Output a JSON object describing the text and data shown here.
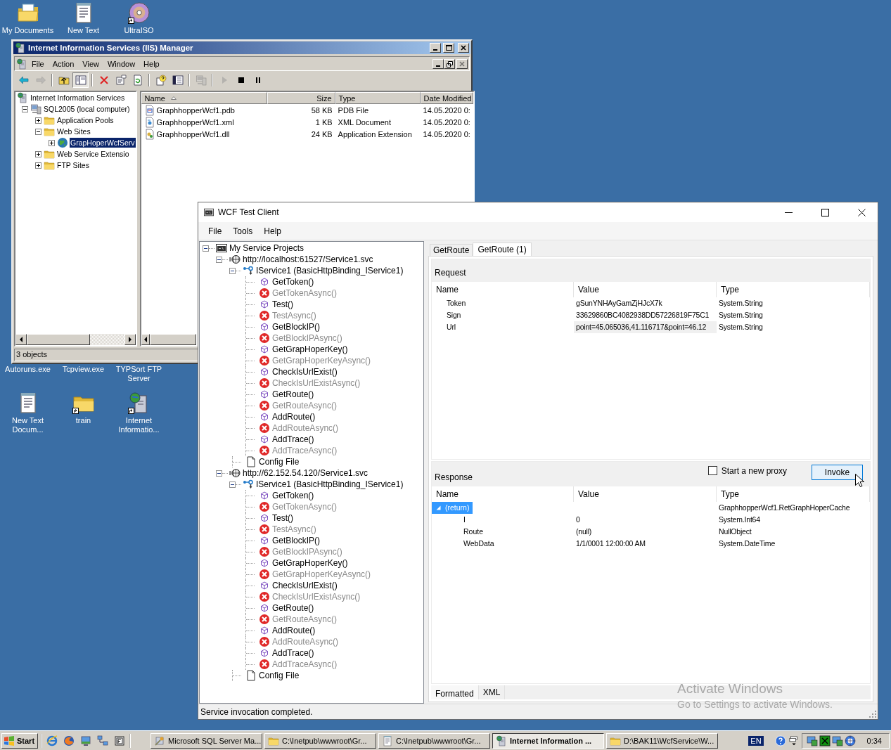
{
  "desktop_icons_top": [
    {
      "label": "My Documents",
      "kind": "documents",
      "shortcut": false
    },
    {
      "label": "New Text",
      "kind": "notepad",
      "shortcut": false
    },
    {
      "label": "UltraISO",
      "kind": "disc",
      "shortcut": true
    }
  ],
  "desktop_labels_covered": [
    "Autoruns.exe",
    "Tcpview.exe",
    "TYPSort FTP Server"
  ],
  "desktop_icons_bottom": [
    {
      "label": "New Text Docum...",
      "kind": "notepad",
      "shortcut": false
    },
    {
      "label": "train",
      "kind": "folder",
      "shortcut": true
    },
    {
      "label": "Internet Informatio...",
      "kind": "iis",
      "shortcut": true
    }
  ],
  "iis_window": {
    "title": "Internet Information Services (IIS) Manager",
    "menu": [
      "File",
      "Action",
      "View",
      "Window",
      "Help"
    ],
    "toolbar": [
      {
        "kind": "back",
        "disabled": false,
        "pressed": false
      },
      {
        "kind": "forward",
        "disabled": true,
        "pressed": false
      },
      {
        "kind": "separator"
      },
      {
        "kind": "up",
        "disabled": false,
        "pressed": false
      },
      {
        "kind": "tree",
        "disabled": false,
        "pressed": true
      },
      {
        "kind": "separator"
      },
      {
        "kind": "delete",
        "disabled": false,
        "pressed": false
      },
      {
        "kind": "properties",
        "disabled": false,
        "pressed": false
      },
      {
        "kind": "refresh",
        "disabled": false,
        "pressed": false
      },
      {
        "kind": "separator"
      },
      {
        "kind": "help",
        "disabled": false,
        "pressed": false
      },
      {
        "kind": "panel",
        "disabled": false,
        "pressed": false
      },
      {
        "kind": "separator"
      },
      {
        "kind": "computer",
        "disabled": true,
        "pressed": false
      },
      {
        "kind": "separator"
      },
      {
        "kind": "play",
        "disabled": true,
        "pressed": false
      },
      {
        "kind": "stop",
        "disabled": false,
        "pressed": false
      },
      {
        "kind": "pause",
        "disabled": false,
        "pressed": false
      }
    ],
    "tree": [
      {
        "label": "Internet Information Services",
        "kind": "iis",
        "selected": false,
        "children": [
          {
            "label": "SQL2005 (local computer)",
            "kind": "computer",
            "expanded": true,
            "selected": false,
            "children": [
              {
                "label": "Application Pools",
                "kind": "folder",
                "expanded": false,
                "selected": false
              },
              {
                "label": "Web Sites",
                "kind": "folder",
                "expanded": true,
                "selected": false,
                "children": [
                  {
                    "label": "GrapHoperWcfServ",
                    "kind": "website",
                    "expanded": false,
                    "selected": true
                  }
                ]
              },
              {
                "label": "Web Service Extensio",
                "kind": "folder",
                "expanded": false,
                "selected": false
              },
              {
                "label": "FTP Sites",
                "kind": "folder",
                "expanded": false,
                "selected": false
              }
            ]
          }
        ]
      }
    ],
    "columns": [
      {
        "label": "Name",
        "sorted": true
      },
      {
        "label": "Size",
        "sorted": false
      },
      {
        "label": "Type",
        "sorted": false
      },
      {
        "label": "Date Modified",
        "sorted": false
      }
    ],
    "rows": [
      {
        "kind": "pdb",
        "cells": [
          "GraphhopperWcf1.pdb",
          "58 KB",
          "PDB File",
          "14.05.2020 0:"
        ]
      },
      {
        "kind": "xml",
        "cells": [
          "GraphhopperWcf1.xml",
          "1 KB",
          "XML Document",
          "14.05.2020 0:"
        ]
      },
      {
        "kind": "dll",
        "cells": [
          "GraphhopperWcf1.dll",
          "24 KB",
          "Application Extension",
          "14.05.2020 0:"
        ]
      }
    ],
    "status": "3 objects"
  },
  "wcf_window": {
    "title": "WCF Test Client",
    "menu": [
      "File",
      "Tools",
      "Help"
    ],
    "tree": [
      {
        "label": "My Service Projects",
        "kind": "project",
        "expanded": true,
        "children": [
          {
            "label": "http://localhost:61527/Service1.svc",
            "kind": "endpoint",
            "expanded": true,
            "children": [
              {
                "label": "IService1 (BasicHttpBinding_IService1)",
                "kind": "contract",
                "expanded": true,
                "children": [
                  {
                    "label": "GetToken()",
                    "kind": "operation"
                  },
                  {
                    "label": "GetTokenAsync()",
                    "kind": "unsupported"
                  },
                  {
                    "label": "Test()",
                    "kind": "operation"
                  },
                  {
                    "label": "TestAsync()",
                    "kind": "unsupported"
                  },
                  {
                    "label": "GetBlockIP()",
                    "kind": "operation"
                  },
                  {
                    "label": "GetBlockIPAsync()",
                    "kind": "unsupported"
                  },
                  {
                    "label": "GetGrapHoperKey()",
                    "kind": "operation"
                  },
                  {
                    "label": "GetGrapHoperKeyAsync()",
                    "kind": "unsupported"
                  },
                  {
                    "label": "CheckIsUrlExist()",
                    "kind": "operation"
                  },
                  {
                    "label": "CheckIsUrlExistAsync()",
                    "kind": "unsupported"
                  },
                  {
                    "label": "GetRoute()",
                    "kind": "operation"
                  },
                  {
                    "label": "GetRouteAsync()",
                    "kind": "unsupported"
                  },
                  {
                    "label": "AddRoute()",
                    "kind": "operation"
                  },
                  {
                    "label": "AddRouteAsync()",
                    "kind": "unsupported"
                  },
                  {
                    "label": "AddTrace()",
                    "kind": "operation"
                  },
                  {
                    "label": "AddTraceAsync()",
                    "kind": "unsupported"
                  }
                ]
              },
              {
                "label": "Config File",
                "kind": "config"
              }
            ]
          },
          {
            "label": "http://62.152.54.120/Service1.svc",
            "kind": "endpoint",
            "expanded": true,
            "children": [
              {
                "label": "IService1 (BasicHttpBinding_IService1)",
                "kind": "contract",
                "expanded": true,
                "children": [
                  {
                    "label": "GetToken()",
                    "kind": "operation"
                  },
                  {
                    "label": "GetTokenAsync()",
                    "kind": "unsupported"
                  },
                  {
                    "label": "Test()",
                    "kind": "operation"
                  },
                  {
                    "label": "TestAsync()",
                    "kind": "unsupported"
                  },
                  {
                    "label": "GetBlockIP()",
                    "kind": "operation"
                  },
                  {
                    "label": "GetBlockIPAsync()",
                    "kind": "unsupported"
                  },
                  {
                    "label": "GetGrapHoperKey()",
                    "kind": "operation"
                  },
                  {
                    "label": "GetGrapHoperKeyAsync()",
                    "kind": "unsupported"
                  },
                  {
                    "label": "CheckIsUrlExist()",
                    "kind": "operation"
                  },
                  {
                    "label": "CheckIsUrlExistAsync()",
                    "kind": "unsupported"
                  },
                  {
                    "label": "GetRoute()",
                    "kind": "operation"
                  },
                  {
                    "label": "GetRouteAsync()",
                    "kind": "unsupported"
                  },
                  {
                    "label": "AddRoute()",
                    "kind": "operation"
                  },
                  {
                    "label": "AddRouteAsync()",
                    "kind": "unsupported"
                  },
                  {
                    "label": "AddTrace()",
                    "kind": "operation"
                  },
                  {
                    "label": "AddTraceAsync()",
                    "kind": "unsupported"
                  }
                ]
              },
              {
                "label": "Config File",
                "kind": "config"
              }
            ]
          }
        ]
      }
    ],
    "tabs": [
      {
        "label": "GetRoute",
        "selected": false
      },
      {
        "label": "GetRoute (1)",
        "selected": true
      }
    ],
    "request": {
      "title": "Request",
      "columns": [
        "Name",
        "Value",
        "Type"
      ],
      "rows": [
        {
          "name": "Token",
          "value": "gSunYNHAyGamZjHJcX7k",
          "type": "System.String",
          "editing": false
        },
        {
          "name": "Sign",
          "value": "33629860BC4082938DD57226819F75C1",
          "type": "System.String",
          "editing": false
        },
        {
          "name": "Url",
          "value": "point=45.065036,41.116717&point=46.12",
          "type": "System.String",
          "editing": true
        }
      ]
    },
    "start_new_proxy": {
      "label": "Start a new proxy",
      "checked": false
    },
    "invoke_button": "Invoke",
    "response": {
      "title": "Response",
      "columns": [
        "Name",
        "Value",
        "Type"
      ],
      "rows": [
        {
          "name": "(return)",
          "type": "GraphhopperWcf1.RetGraphHoperCache",
          "expanded": true,
          "selected": true,
          "children": [
            {
              "name": "I",
              "value": "0",
              "type": "System.Int64",
              "selected": false
            },
            {
              "name": "Route",
              "value": "(null)",
              "type": "NullObject",
              "selected": false
            },
            {
              "name": "WebData",
              "value": "1/1/0001 12:00:00 AM",
              "type": "System.DateTime",
              "selected": false
            }
          ]
        }
      ]
    },
    "view_tabs": [
      {
        "label": "Formatted",
        "selected": true
      },
      {
        "label": "XML",
        "selected": false
      }
    ],
    "status": "Service invocation completed."
  },
  "watermark": {
    "title": "Activate Windows",
    "subtitle": "Go to Settings to activate Windows."
  },
  "taskbar": {
    "start": "Start",
    "tasks": [
      {
        "label": "Microsoft SQL Server Ma...",
        "kind": "tools",
        "selected": false
      },
      {
        "label": "C:\\Inetpub\\wwwroot\\Gr...",
        "kind": "folder",
        "selected": false
      },
      {
        "label": "C:\\Inetpub\\wwwroot\\Gr...",
        "kind": "notepad",
        "selected": false
      },
      {
        "label": "Internet Information ...",
        "kind": "iis",
        "selected": true
      },
      {
        "label": "D:\\BAK11\\WcfService\\W...",
        "kind": "folder",
        "selected": false
      }
    ],
    "language": "EN",
    "clock": "0:34"
  }
}
